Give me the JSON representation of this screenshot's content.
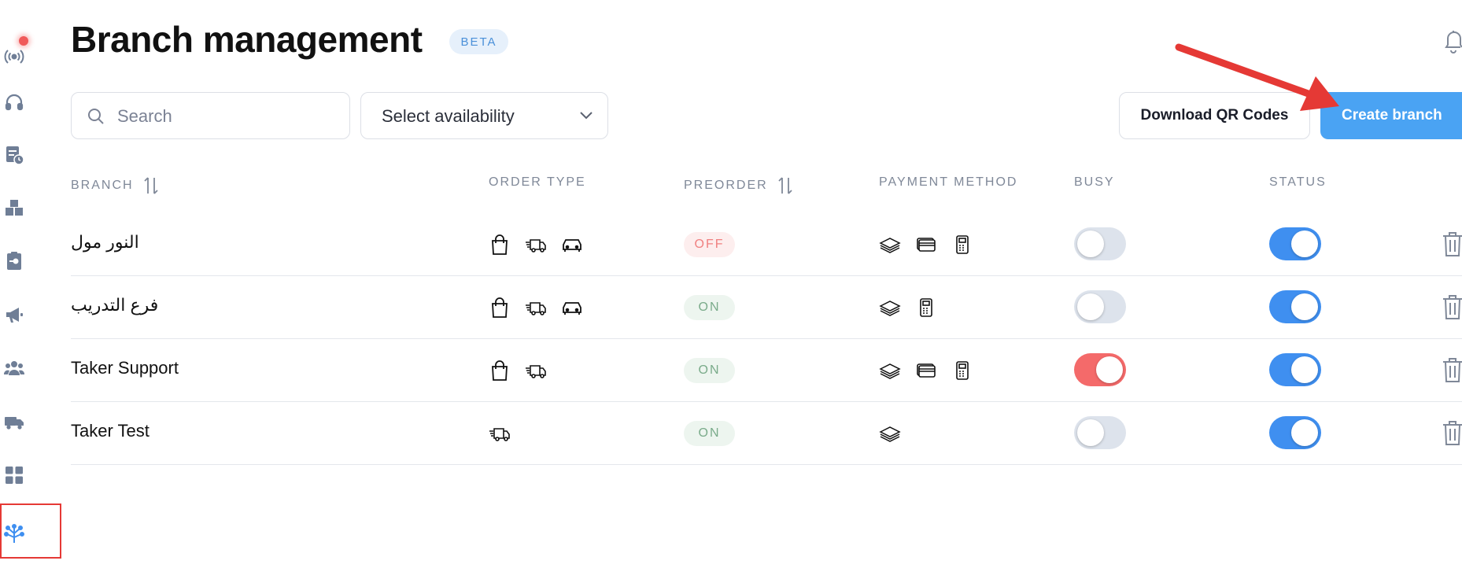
{
  "header": {
    "title": "Branch management",
    "badge": "BETA"
  },
  "toolbar": {
    "search_placeholder": "Search",
    "availability_label": "Select availability",
    "download_label": "Download QR Codes",
    "create_label": "Create branch"
  },
  "table": {
    "columns": {
      "branch": "BRANCH",
      "order_type": "ORDER TYPE",
      "preorder": "PREORDER",
      "payment_method": "PAYMENT METHOD",
      "busy": "BUSY",
      "status": "STATUS"
    },
    "rows": [
      {
        "name": "النور مول",
        "order_types": [
          "bag-icon",
          "delivery-truck-icon",
          "car-icon"
        ],
        "preorder": "OFF",
        "payments": [
          "cash-icon",
          "card-icon",
          "pos-terminal-icon"
        ],
        "busy": false,
        "status": true
      },
      {
        "name": "فرع التدريب",
        "order_types": [
          "bag-icon",
          "delivery-truck-icon",
          "car-icon"
        ],
        "preorder": "ON",
        "payments": [
          "cash-icon",
          "pos-terminal-icon"
        ],
        "busy": false,
        "status": true
      },
      {
        "name": "Taker Support",
        "order_types": [
          "bag-icon",
          "delivery-truck-icon"
        ],
        "preorder": "ON",
        "payments": [
          "cash-icon",
          "card-icon",
          "pos-terminal-icon"
        ],
        "busy": true,
        "status": true
      },
      {
        "name": "Taker Test",
        "order_types": [
          "delivery-truck-icon"
        ],
        "preorder": "ON",
        "payments": [
          "cash-icon"
        ],
        "busy": false,
        "status": true
      }
    ]
  },
  "sidebar": {
    "items": [
      "live-icon",
      "headset-icon",
      "orders-icon",
      "inventory-icon",
      "reports-icon",
      "megaphone-icon",
      "customers-icon",
      "delivery-icon",
      "dashboard-icon",
      "branches-icon"
    ],
    "active": "branches-icon"
  },
  "colors": {
    "accent": "#4aa3f3",
    "busy_on": "#f46a6a",
    "status_on": "#3f8ff0",
    "annotation": "#e53935"
  }
}
